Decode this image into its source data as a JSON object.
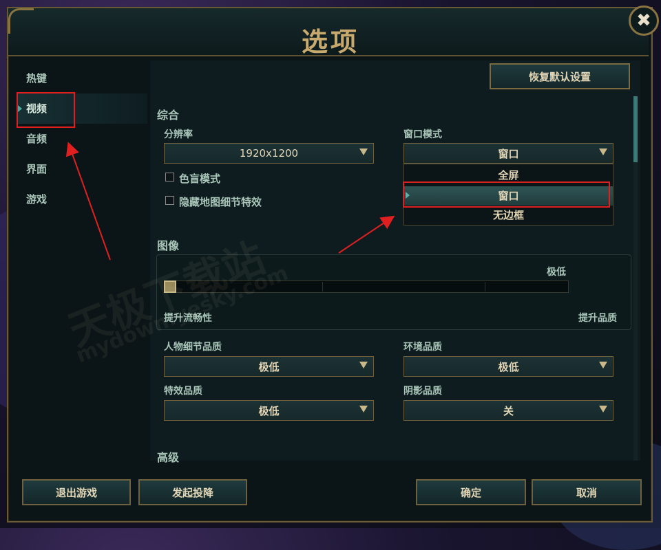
{
  "window": {
    "title": "选项",
    "close_glyph": "✖",
    "reset_button": "恢复默认设置"
  },
  "sidebar": {
    "items": [
      {
        "label": "热键"
      },
      {
        "label": "视频",
        "active": true
      },
      {
        "label": "音频"
      },
      {
        "label": "界面"
      },
      {
        "label": "游戏"
      }
    ]
  },
  "general": {
    "section_title": "综合",
    "resolution_label": "分辨率",
    "resolution_value": "1920x1200",
    "window_mode_label": "窗口模式",
    "window_mode_value": "窗口",
    "window_mode_options": [
      "全屏",
      "窗口",
      "无边框"
    ],
    "window_mode_selected": "窗口",
    "colorblind_label": "色盲模式",
    "colorblind_checked": false,
    "hide_map_detail_label": "隐藏地图细节特效",
    "hide_map_detail_checked": false
  },
  "graphics": {
    "section_title": "图像",
    "quality_level_text": "极低",
    "quality_level": 0,
    "left_hint": "提升流畅性",
    "right_hint": "提升品质",
    "character_quality_label": "人物细节品质",
    "character_quality_value": "极低",
    "environment_quality_label": "环境品质",
    "environment_quality_value": "极低",
    "effects_quality_label": "特效品质",
    "effects_quality_value": "极低",
    "shadow_quality_label": "阴影品质",
    "shadow_quality_value": "关"
  },
  "advanced": {
    "section_title": "高级"
  },
  "footer": {
    "quit_button": "退出游戏",
    "surrender_button": "发起投降",
    "confirm_button": "确定",
    "cancel_button": "取消"
  },
  "watermark": {
    "line1": "天极下载站",
    "line2": "mydown.yesky.com"
  },
  "colors": {
    "gold_border": "#6d6140",
    "text_gold": "#c8aa6e",
    "text_teal": "#a9c6b9",
    "highlight_red": "#e02020"
  }
}
